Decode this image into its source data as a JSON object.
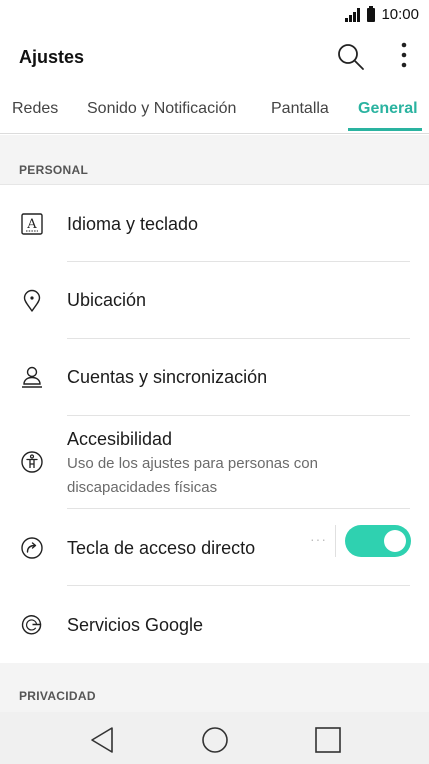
{
  "status_bar": {
    "time": "10:00",
    "signal_icon": "signal-icon",
    "battery_icon": "battery-icon"
  },
  "app_bar": {
    "title": "Ajustes",
    "search_icon": "search-icon",
    "more_icon": "more-vert-icon"
  },
  "tabs": [
    {
      "label": "Redes",
      "active": false
    },
    {
      "label": "Sonido y Notificación",
      "active": false
    },
    {
      "label": "Pantalla",
      "active": false
    },
    {
      "label": "General",
      "active": true
    }
  ],
  "sections": {
    "personal": {
      "header": "PERSONAL",
      "items": [
        {
          "label": "Idioma y teclado",
          "icon": "language-keyboard-icon"
        },
        {
          "label": "Ubicación",
          "icon": "location-pin-icon"
        },
        {
          "label": "Cuentas y sincronización",
          "icon": "account-sync-icon"
        },
        {
          "label": "Accesibilidad",
          "sublabel": "Uso de los ajustes para personas con discapacidades físicas",
          "icon": "accessibility-icon"
        },
        {
          "label": "Tecla de acceso directo",
          "icon": "shortcut-key-icon",
          "toggle_on": true
        },
        {
          "label": "Servicios Google",
          "icon": "google-icon"
        }
      ]
    },
    "privacy": {
      "header": "PRIVACIDAD"
    }
  },
  "colors": {
    "accent": "#2ab3a0",
    "toggle": "#2fd1b0"
  },
  "nav_bar": {
    "back_icon": "back-triangle-icon",
    "home_icon": "home-circle-icon",
    "recents_icon": "recents-square-icon"
  }
}
